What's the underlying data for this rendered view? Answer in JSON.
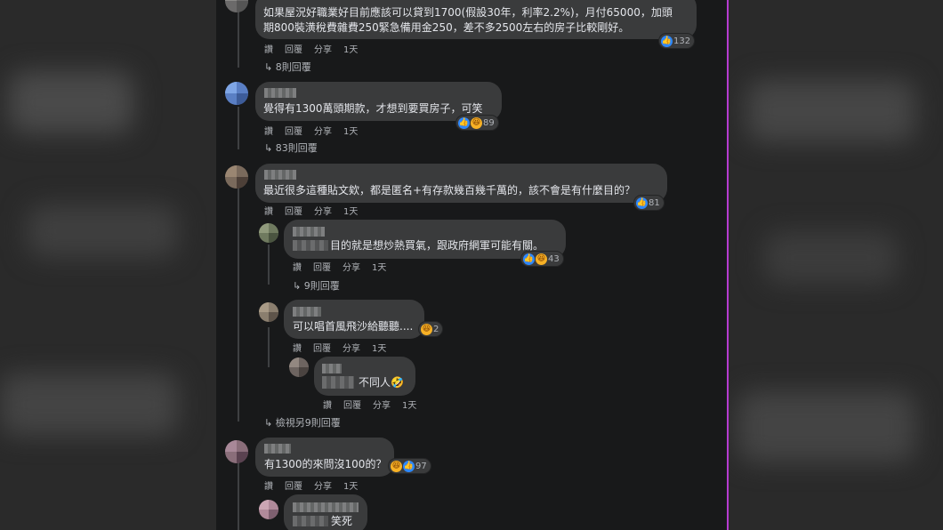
{
  "actions": {
    "like": "讚",
    "reply": "回覆",
    "share": "分享",
    "time": "1天"
  },
  "comments": [
    {
      "text_line1": "如果屋況好職業好目前應該可以貸到1700(假設30年，利率2.2%)，月付65000，加頭",
      "text_line2": "期800裝潢稅費雜費250緊急備用金250，差不多2500左右的房子比較剛好。",
      "reaction_count": "132",
      "view_replies": "8則回覆"
    },
    {
      "text": "覺得有1300萬頭期款，才想到要買房子，可笑",
      "reaction_count": "89",
      "view_replies": "83則回覆"
    },
    {
      "text": "最近很多這種貼文欸，都是匿名+有存款幾百幾千萬的，該不會是有什麼目的？",
      "reaction_count": "81",
      "replies": [
        {
          "text": "目的就是想炒熱買氣，跟政府網軍可能有關。",
          "reaction_count": "43",
          "view_replies": "9則回覆"
        },
        {
          "text": "可以唱首風飛沙給聽聽....",
          "reaction_count": "2"
        },
        {
          "text": "不同人",
          "emoji": "🤣"
        }
      ],
      "view_more_replies": "檢視另9則回覆"
    },
    {
      "text": "有1300的來問沒100的？",
      "reaction_count": "97"
    },
    {
      "text": "笑死"
    }
  ],
  "colors": {
    "accent_like": "#2d88ff",
    "accent_haha": "#f7b125",
    "bubble": "#3a3b3c",
    "panel": "#18191a"
  }
}
